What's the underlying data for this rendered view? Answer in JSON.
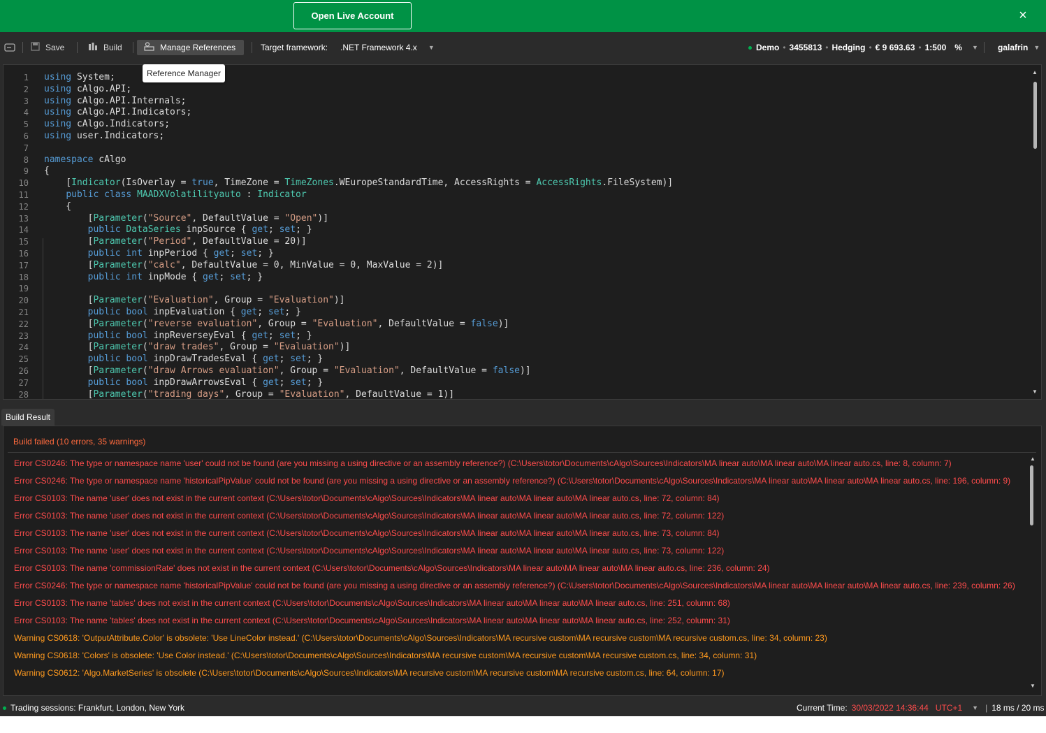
{
  "banner": {
    "button_label": "Open Live Account",
    "close_icon": "×"
  },
  "toolbar": {
    "save_label": "Save",
    "build_label": "Build",
    "manage_refs_label": "Manage References",
    "target_framework_label": "Target framework:",
    "target_framework_value": ".NET Framework 4.x",
    "account": {
      "mode": "Demo",
      "number": "3455813",
      "type": "Hedging",
      "balance": "€ 9 693.63",
      "leverage": "1:500",
      "percent": "%"
    },
    "user": "galafrin"
  },
  "tooltip": "Reference Manager",
  "editor": {
    "line_numbers": [
      "1",
      "2",
      "3",
      "4",
      "5",
      "6",
      "7",
      "8",
      "9",
      "10",
      "11",
      "12",
      "13",
      "14",
      "15",
      "16",
      "17",
      "18",
      "19",
      "20",
      "21",
      "22",
      "23",
      "24",
      "25",
      "26",
      "27",
      "28"
    ]
  },
  "build_result": {
    "tab_label": "Build Result",
    "summary": "Build failed (10 errors, 35 warnings)",
    "messages": [
      {
        "kind": "error",
        "text": "Error CS0246: The type or namespace name 'user' could not be found (are you missing a using directive or an assembly reference?) (C:\\Users\\totor\\Documents\\cAlgo\\Sources\\Indicators\\MA linear auto\\MA linear auto\\MA linear auto.cs, line: 8, column: 7)"
      },
      {
        "kind": "error",
        "text": "Error CS0246: The type or namespace name 'historicalPipValue' could not be found (are you missing a using directive or an assembly reference?) (C:\\Users\\totor\\Documents\\cAlgo\\Sources\\Indicators\\MA linear auto\\MA linear auto\\MA linear auto.cs, line: 196, column: 9)"
      },
      {
        "kind": "error",
        "text": "Error CS0103: The name 'user' does not exist in the current context (C:\\Users\\totor\\Documents\\cAlgo\\Sources\\Indicators\\MA linear auto\\MA linear auto\\MA linear auto.cs, line: 72, column: 84)"
      },
      {
        "kind": "error",
        "text": "Error CS0103: The name 'user' does not exist in the current context (C:\\Users\\totor\\Documents\\cAlgo\\Sources\\Indicators\\MA linear auto\\MA linear auto\\MA linear auto.cs, line: 72, column: 122)"
      },
      {
        "kind": "error",
        "text": "Error CS0103: The name 'user' does not exist in the current context (C:\\Users\\totor\\Documents\\cAlgo\\Sources\\Indicators\\MA linear auto\\MA linear auto\\MA linear auto.cs, line: 73, column: 84)"
      },
      {
        "kind": "error",
        "text": "Error CS0103: The name 'user' does not exist in the current context (C:\\Users\\totor\\Documents\\cAlgo\\Sources\\Indicators\\MA linear auto\\MA linear auto\\MA linear auto.cs, line: 73, column: 122)"
      },
      {
        "kind": "error",
        "text": "Error CS0103: The name 'commissionRate' does not exist in the current context (C:\\Users\\totor\\Documents\\cAlgo\\Sources\\Indicators\\MA linear auto\\MA linear auto\\MA linear auto.cs, line: 236, column: 24)"
      },
      {
        "kind": "error",
        "text": "Error CS0246: The type or namespace name 'historicalPipValue' could not be found (are you missing a using directive or an assembly reference?) (C:\\Users\\totor\\Documents\\cAlgo\\Sources\\Indicators\\MA linear auto\\MA linear auto\\MA linear auto.cs, line: 239, column: 26)"
      },
      {
        "kind": "error",
        "text": "Error CS0103: The name 'tables' does not exist in the current context (C:\\Users\\totor\\Documents\\cAlgo\\Sources\\Indicators\\MA linear auto\\MA linear auto\\MA linear auto.cs, line: 251, column: 68)"
      },
      {
        "kind": "error",
        "text": "Error CS0103: The name 'tables' does not exist in the current context (C:\\Users\\totor\\Documents\\cAlgo\\Sources\\Indicators\\MA linear auto\\MA linear auto\\MA linear auto.cs, line: 252, column: 31)"
      },
      {
        "kind": "warning",
        "text": "Warning CS0618: 'OutputAttribute.Color' is obsolete: 'Use LineColor instead.' (C:\\Users\\totor\\Documents\\cAlgo\\Sources\\Indicators\\MA recursive custom\\MA recursive custom\\MA recursive custom.cs, line: 34, column: 23)"
      },
      {
        "kind": "warning",
        "text": "Warning CS0618: 'Colors' is obsolete: 'Use Color instead.' (C:\\Users\\totor\\Documents\\cAlgo\\Sources\\Indicators\\MA recursive custom\\MA recursive custom\\MA recursive custom.cs, line: 34, column: 31)"
      },
      {
        "kind": "warning",
        "text": "Warning CS0612: 'Algo.MarketSeries' is obsolete (C:\\Users\\totor\\Documents\\cAlgo\\Sources\\Indicators\\MA recursive custom\\MA recursive custom\\MA recursive custom.cs, line: 64, column: 17)"
      }
    ]
  },
  "statusbar": {
    "sessions": "Trading sessions: Frankfurt, London, New York",
    "current_time_label": "Current Time:",
    "current_time_value": "30/03/2022 14:36:44",
    "timezone": "UTC+1",
    "latency": "18 ms / 20 ms"
  }
}
